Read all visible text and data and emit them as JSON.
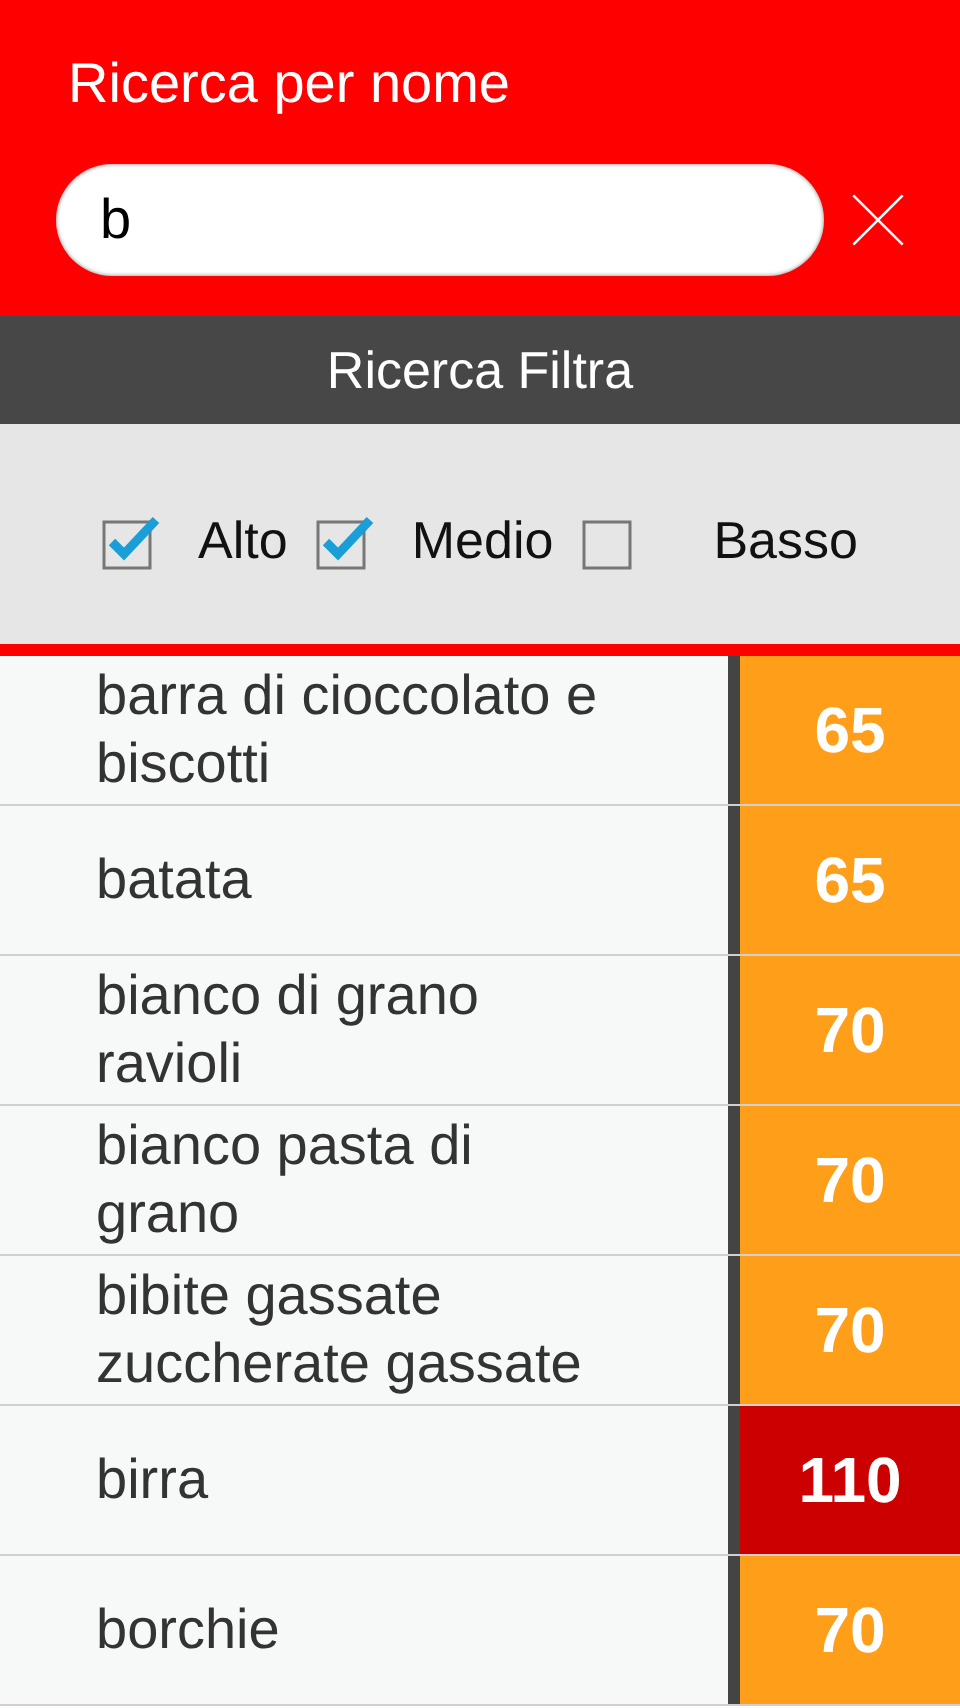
{
  "header": {
    "title": "Ricerca per nome",
    "search": {
      "value": "b"
    }
  },
  "filter_bar": {
    "title": "Ricerca Filtra"
  },
  "filters": [
    {
      "label": "Alto",
      "checked": true
    },
    {
      "label": "Medio",
      "checked": true
    },
    {
      "label": "Basso",
      "checked": false
    }
  ],
  "rows": [
    {
      "name": "barra di cioccolato e biscotti",
      "value": "65",
      "color": "#ff9e18"
    },
    {
      "name": "batata",
      "value": "65",
      "color": "#ff9e18"
    },
    {
      "name": "bianco di grano ravioli",
      "value": "70",
      "color": "#ff9e18"
    },
    {
      "name": "bianco pasta di grano",
      "value": "70",
      "color": "#ff9e18"
    },
    {
      "name": "bibite gassate zuccherate gassate",
      "value": "70",
      "color": "#ff9e18"
    },
    {
      "name": "birra",
      "value": "110",
      "color": "#cc0000"
    },
    {
      "name": "borchie",
      "value": "70",
      "color": "#ff9e18"
    }
  ]
}
